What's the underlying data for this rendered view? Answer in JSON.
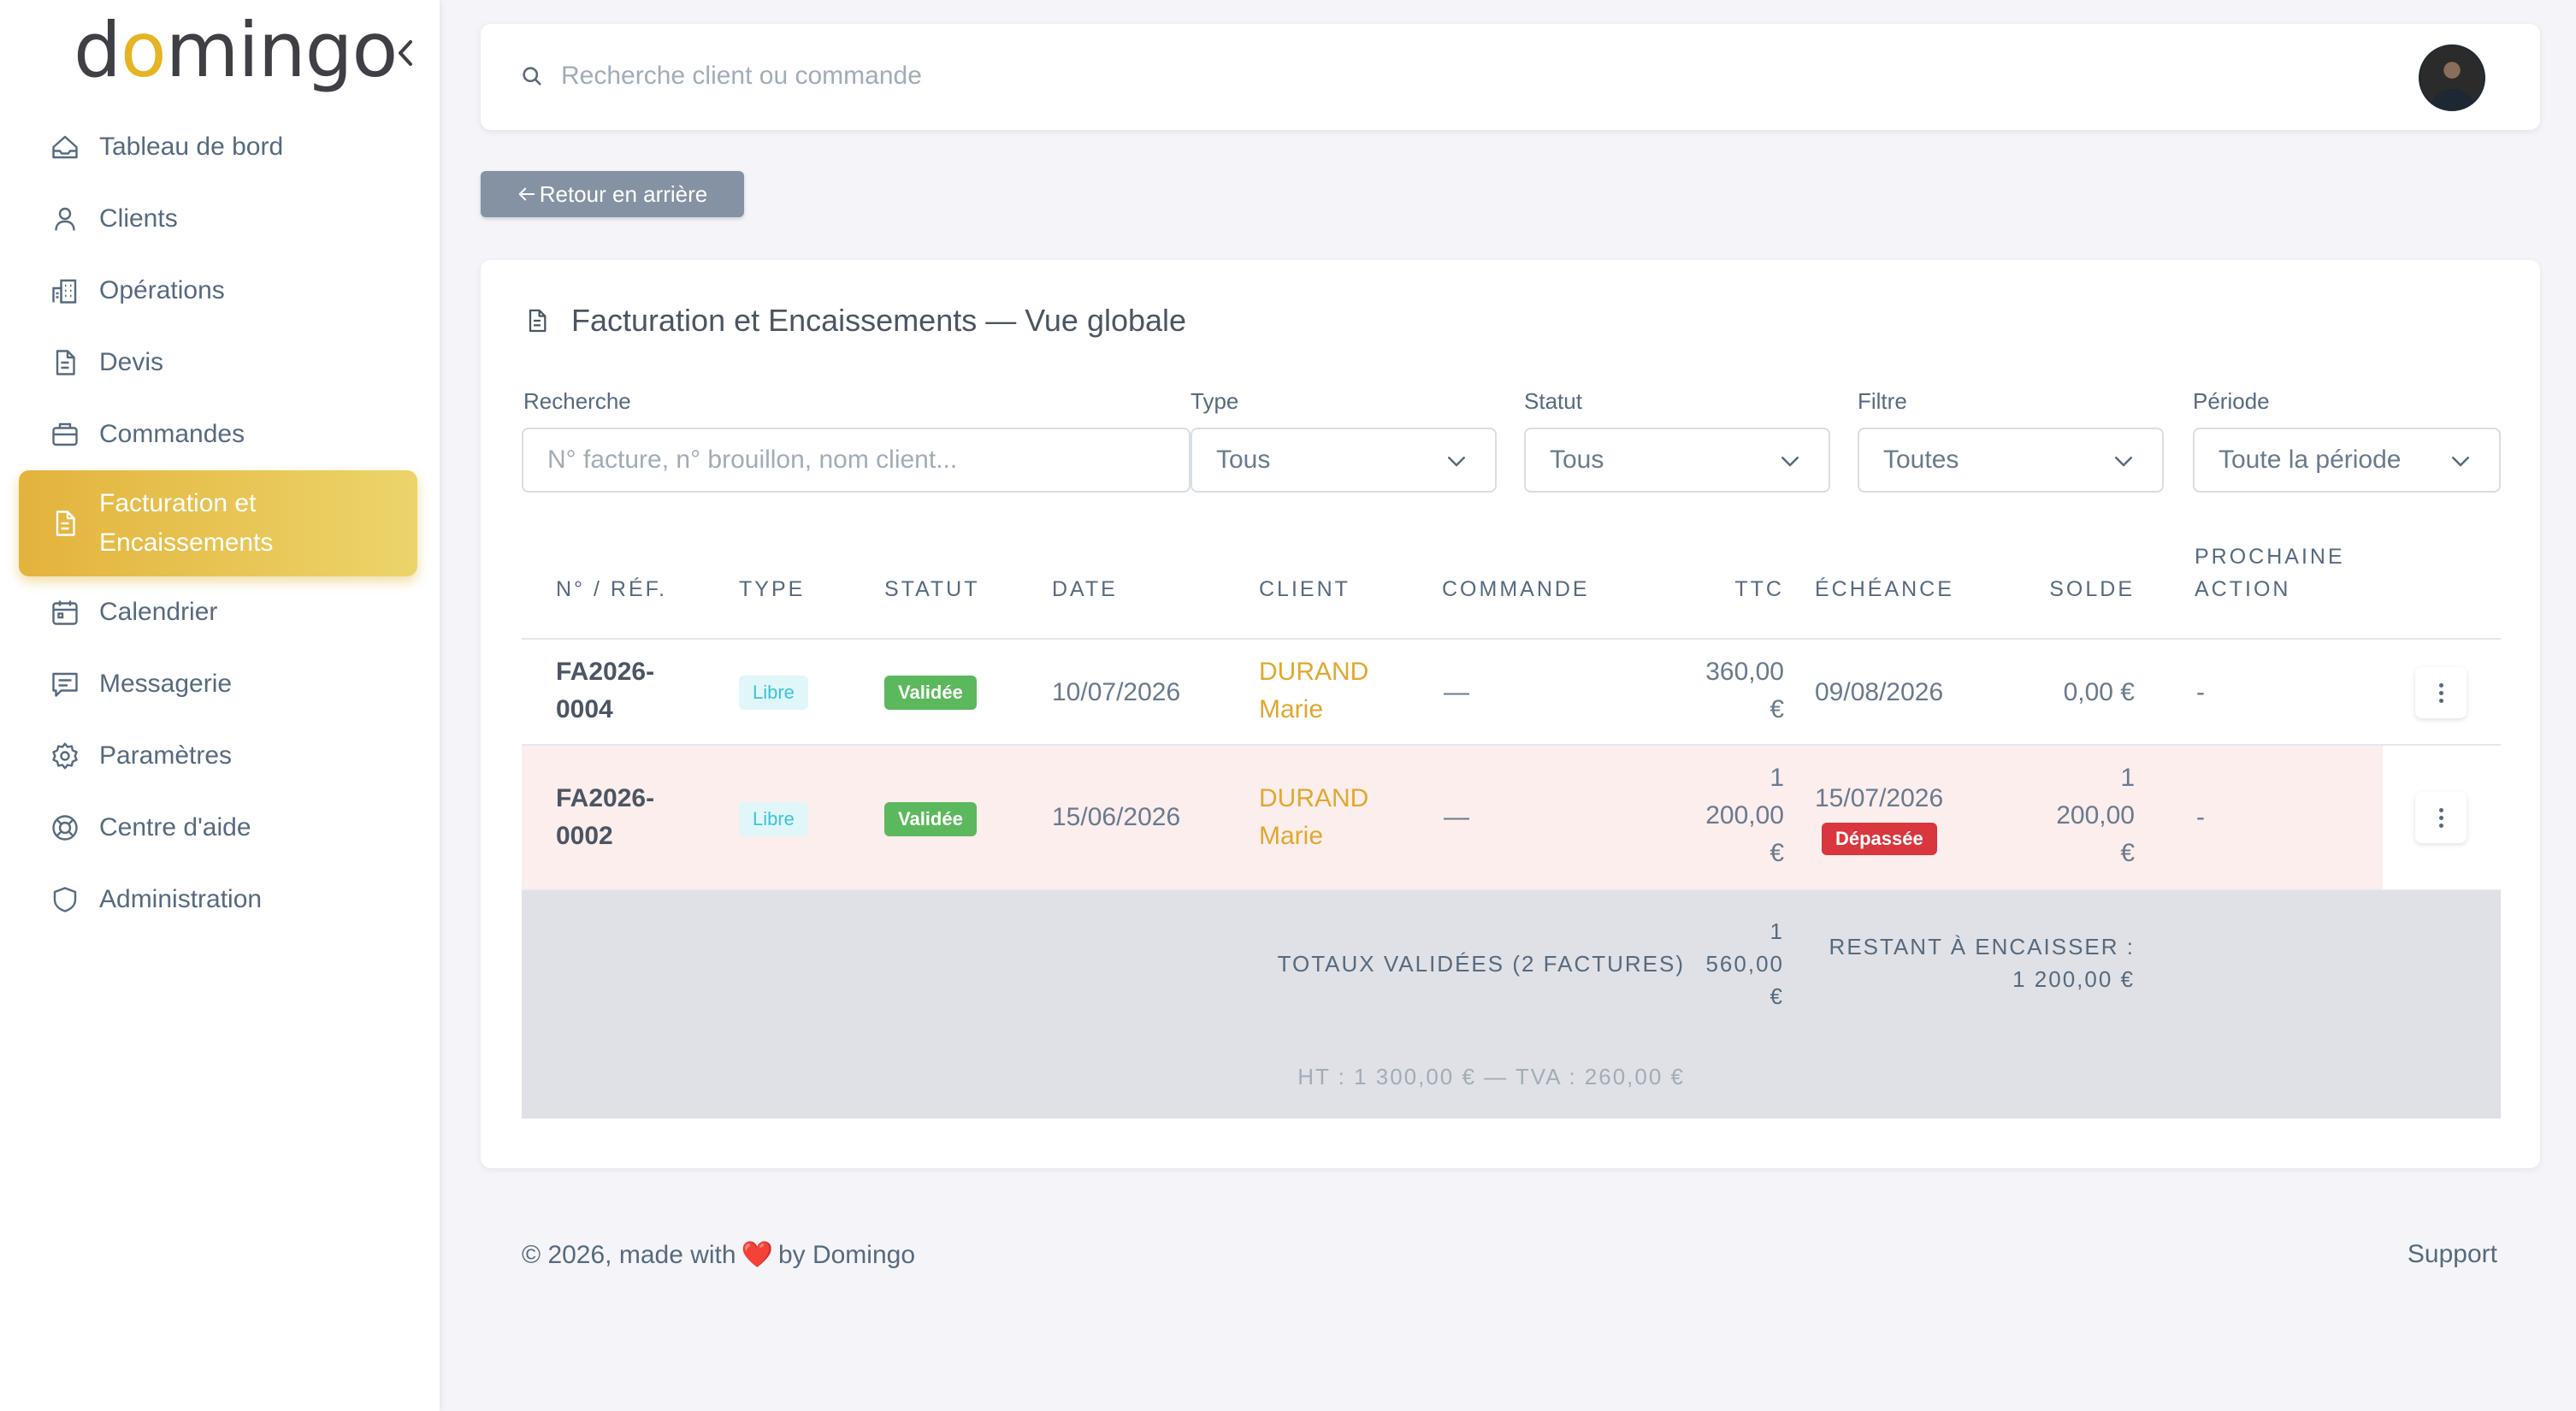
{
  "brand": {
    "name_prefix": "d",
    "name_o": "o",
    "name_suffix": "mingo"
  },
  "sidebar": {
    "items": [
      {
        "label": "Tableau de bord",
        "icon": "home-icon"
      },
      {
        "label": "Clients",
        "icon": "user-icon"
      },
      {
        "label": "Opérations",
        "icon": "building-icon"
      },
      {
        "label": "Devis",
        "icon": "document-icon"
      },
      {
        "label": "Commandes",
        "icon": "briefcase-icon"
      },
      {
        "label_line1": "Facturation et",
        "label_line2": "Encaissements",
        "icon": "invoice-icon",
        "active": true
      },
      {
        "label": "Calendrier",
        "icon": "calendar-icon"
      },
      {
        "label": "Messagerie",
        "icon": "message-icon"
      },
      {
        "label": "Paramètres",
        "icon": "gear-icon"
      },
      {
        "label": "Centre d'aide",
        "icon": "lifebuoy-icon"
      },
      {
        "label": "Administration",
        "icon": "shield-icon"
      }
    ]
  },
  "navbar": {
    "search_placeholder": "Recherche client ou commande"
  },
  "back_button": {
    "label": "Retour en arrière"
  },
  "card": {
    "title": "Facturation et Encaissements — Vue globale",
    "filters": {
      "search_label": "Recherche",
      "search_placeholder": "N° facture, n° brouillon, nom client...",
      "type_label": "Type",
      "type_value": "Tous",
      "statut_label": "Statut",
      "statut_value": "Tous",
      "filtre_label": "Filtre",
      "filtre_value": "Toutes",
      "periode_label": "Période",
      "periode_value": "Toute la période"
    },
    "columns": {
      "ref": "N° / RÉF.",
      "type": "TYPE",
      "statut": "STATUT",
      "date": "DATE",
      "client": "CLIENT",
      "commande": "COMMANDE",
      "ttc": "TTC",
      "echeance": "ÉCHÉANCE",
      "solde": "SOLDE",
      "next_line1": "PROCHAINE",
      "next_line2": "ACTION"
    },
    "rows": [
      {
        "ref_line1": "FA2026-",
        "ref_line2": "0004",
        "type": "Libre",
        "statut": "Validée",
        "date": "10/07/2026",
        "client_line1": "DURAND",
        "client_line2": "Marie",
        "commande": "—",
        "ttc_line1": "360,00",
        "ttc_line2": "€",
        "echeance": "09/08/2026",
        "solde": "0,00 €",
        "next": "-"
      },
      {
        "ref_line1": "FA2026-",
        "ref_line2": "0002",
        "type": "Libre",
        "statut": "Validée",
        "date": "15/06/2026",
        "client_line1": "DURAND",
        "client_line2": "Marie",
        "commande": "—",
        "ttc_line1": "1",
        "ttc_line2": "200,00",
        "ttc_line3": "€",
        "echeance": "15/07/2026",
        "echeance_badge": "Dépassée",
        "solde_line1": "1",
        "solde_line2": "200,00",
        "solde_line3": "€",
        "next": "-",
        "highlight_color": "#fbeeed"
      }
    ],
    "totals": {
      "label": "TOTAUX VALIDÉES (2 FACTURES)",
      "ttc_line1": "1",
      "ttc_line2": "560,00",
      "ttc_line3": "€",
      "remaining_line1": "RESTANT À ENCAISSER :",
      "remaining_line2": "1 200,00 €",
      "ht_tva": "HT : 1 300,00 € — TVA : 260,00 €"
    }
  },
  "footer": {
    "left_before": "© 2026, made with",
    "heart": "❤️",
    "left_after": "by Domingo",
    "support": "Support"
  },
  "colors": {
    "accent": "#e3b33c",
    "client_link": "#e0a82e",
    "badge_success": "#5cb85c",
    "badge_danger": "#d9363e",
    "badge_info_text": "#3ec4d7"
  }
}
